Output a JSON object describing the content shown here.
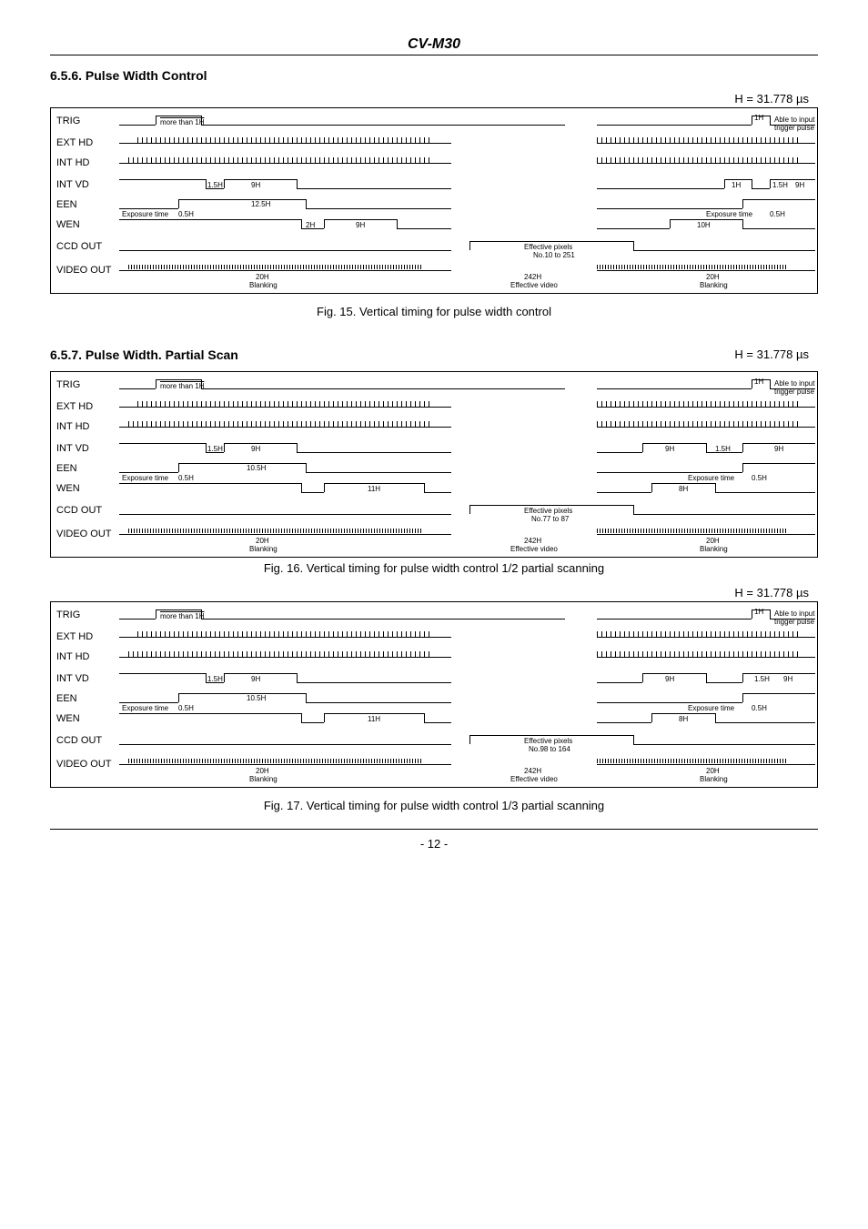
{
  "header": {
    "title": "CV-M30"
  },
  "section656": {
    "title": "6.5.6. Pulse Width Control"
  },
  "section657": {
    "title": "6.5.7. Pulse Width. Partial Scan"
  },
  "h_note": "H = 31.778 µs",
  "fig15": {
    "caption": "Fig. 15. Vertical timing for pulse width control"
  },
  "fig16": {
    "caption": "Fig. 16. Vertical timing for pulse width control 1/2 partial scanning"
  },
  "fig17": {
    "caption": "Fig. 17. Vertical timing for pulse width control 1/3 partial scanning"
  },
  "signals": {
    "trig": "TRIG",
    "exthd": "EXT HD",
    "inthd": "INT HD",
    "intvd": "INT VD",
    "een": "EEN",
    "wen": "WEN",
    "ccdout": "CCD OUT",
    "videoout": "VIDEO OUT"
  },
  "annotations": {
    "more_than_1h": "more than 1H",
    "exposure_time": "Exposure time",
    "zero5h": "0.5H",
    "one5h": "1.5H",
    "twoH": "2H",
    "nineH": "9H",
    "tenH": "10H",
    "elevenH": "11H",
    "eightH": "8H",
    "twelve5h": "12.5H",
    "ten5h": "10.5H",
    "oneH": "1H",
    "twentyH": "20H",
    "blanking": "Blanking",
    "effective_pixels": "Effective pixels",
    "range1": "No.10 to 251",
    "range2": "No.77 to 87",
    "range3": "No.98 to 164",
    "count242": "242H",
    "effective_video": "Effective video",
    "able_to_input": "Able to input",
    "trigger_pulse": "trigger pulse"
  },
  "footer": {
    "page": "- 12 -"
  },
  "chart_data": [
    {
      "type": "timing-diagram",
      "figure": 15,
      "title": "Vertical timing for pulse width control",
      "h_period_us": 31.778,
      "signals": [
        "TRIG",
        "EXT HD",
        "INT HD",
        "INT VD",
        "EEN",
        "WEN",
        "CCD OUT",
        "VIDEO OUT"
      ],
      "trig_min_width": "more than 1H",
      "trig_to_next_able": "1H",
      "exposure_time_offset": "0.5H",
      "int_vd_high_delay": "1.5H",
      "int_vd_high_width": "9H",
      "een_pulse_width": "12.5H",
      "wen_delay": "2H",
      "wen_width": "9H",
      "wen_second_width": "10H",
      "effective_pixels_range": "No.10 to 251",
      "video_blanking": "20H",
      "video_frame": "242H"
    },
    {
      "type": "timing-diagram",
      "figure": 16,
      "title": "Vertical timing for pulse width control 1/2 partial scanning",
      "h_period_us": 31.778,
      "signals": [
        "TRIG",
        "EXT HD",
        "INT HD",
        "INT VD",
        "EEN",
        "WEN",
        "CCD OUT",
        "VIDEO OUT"
      ],
      "trig_min_width": "more than 1H",
      "exposure_time_offset": "0.5H",
      "int_vd_high_delay": "1.5H",
      "int_vd_high_width": "9H",
      "een_pulse_width": "10.5H",
      "wen_width": "11H",
      "wen_second_width": "8H",
      "second_int_vd_width": "9H",
      "second_int_vd_delay": "1.5H",
      "effective_pixels_range": "No.77 to 87",
      "video_blanking": "20H",
      "video_frame": "242H"
    },
    {
      "type": "timing-diagram",
      "figure": 17,
      "title": "Vertical timing for pulse width control 1/3 partial scanning",
      "h_period_us": 31.778,
      "signals": [
        "TRIG",
        "EXT HD",
        "INT HD",
        "INT VD",
        "EEN",
        "WEN",
        "CCD OUT",
        "VIDEO OUT"
      ],
      "trig_min_width": "more than 1H",
      "exposure_time_offset": "0.5H",
      "int_vd_high_delay": "1.5H",
      "int_vd_high_width": "9H",
      "een_pulse_width": "10.5H",
      "wen_width": "11H",
      "wen_second_width": "8H",
      "second_int_vd_width": "9H",
      "second_int_vd_delay": "1.5H",
      "effective_pixels_range": "No.98 to 164",
      "video_blanking": "20H",
      "video_frame": "242H"
    }
  ]
}
